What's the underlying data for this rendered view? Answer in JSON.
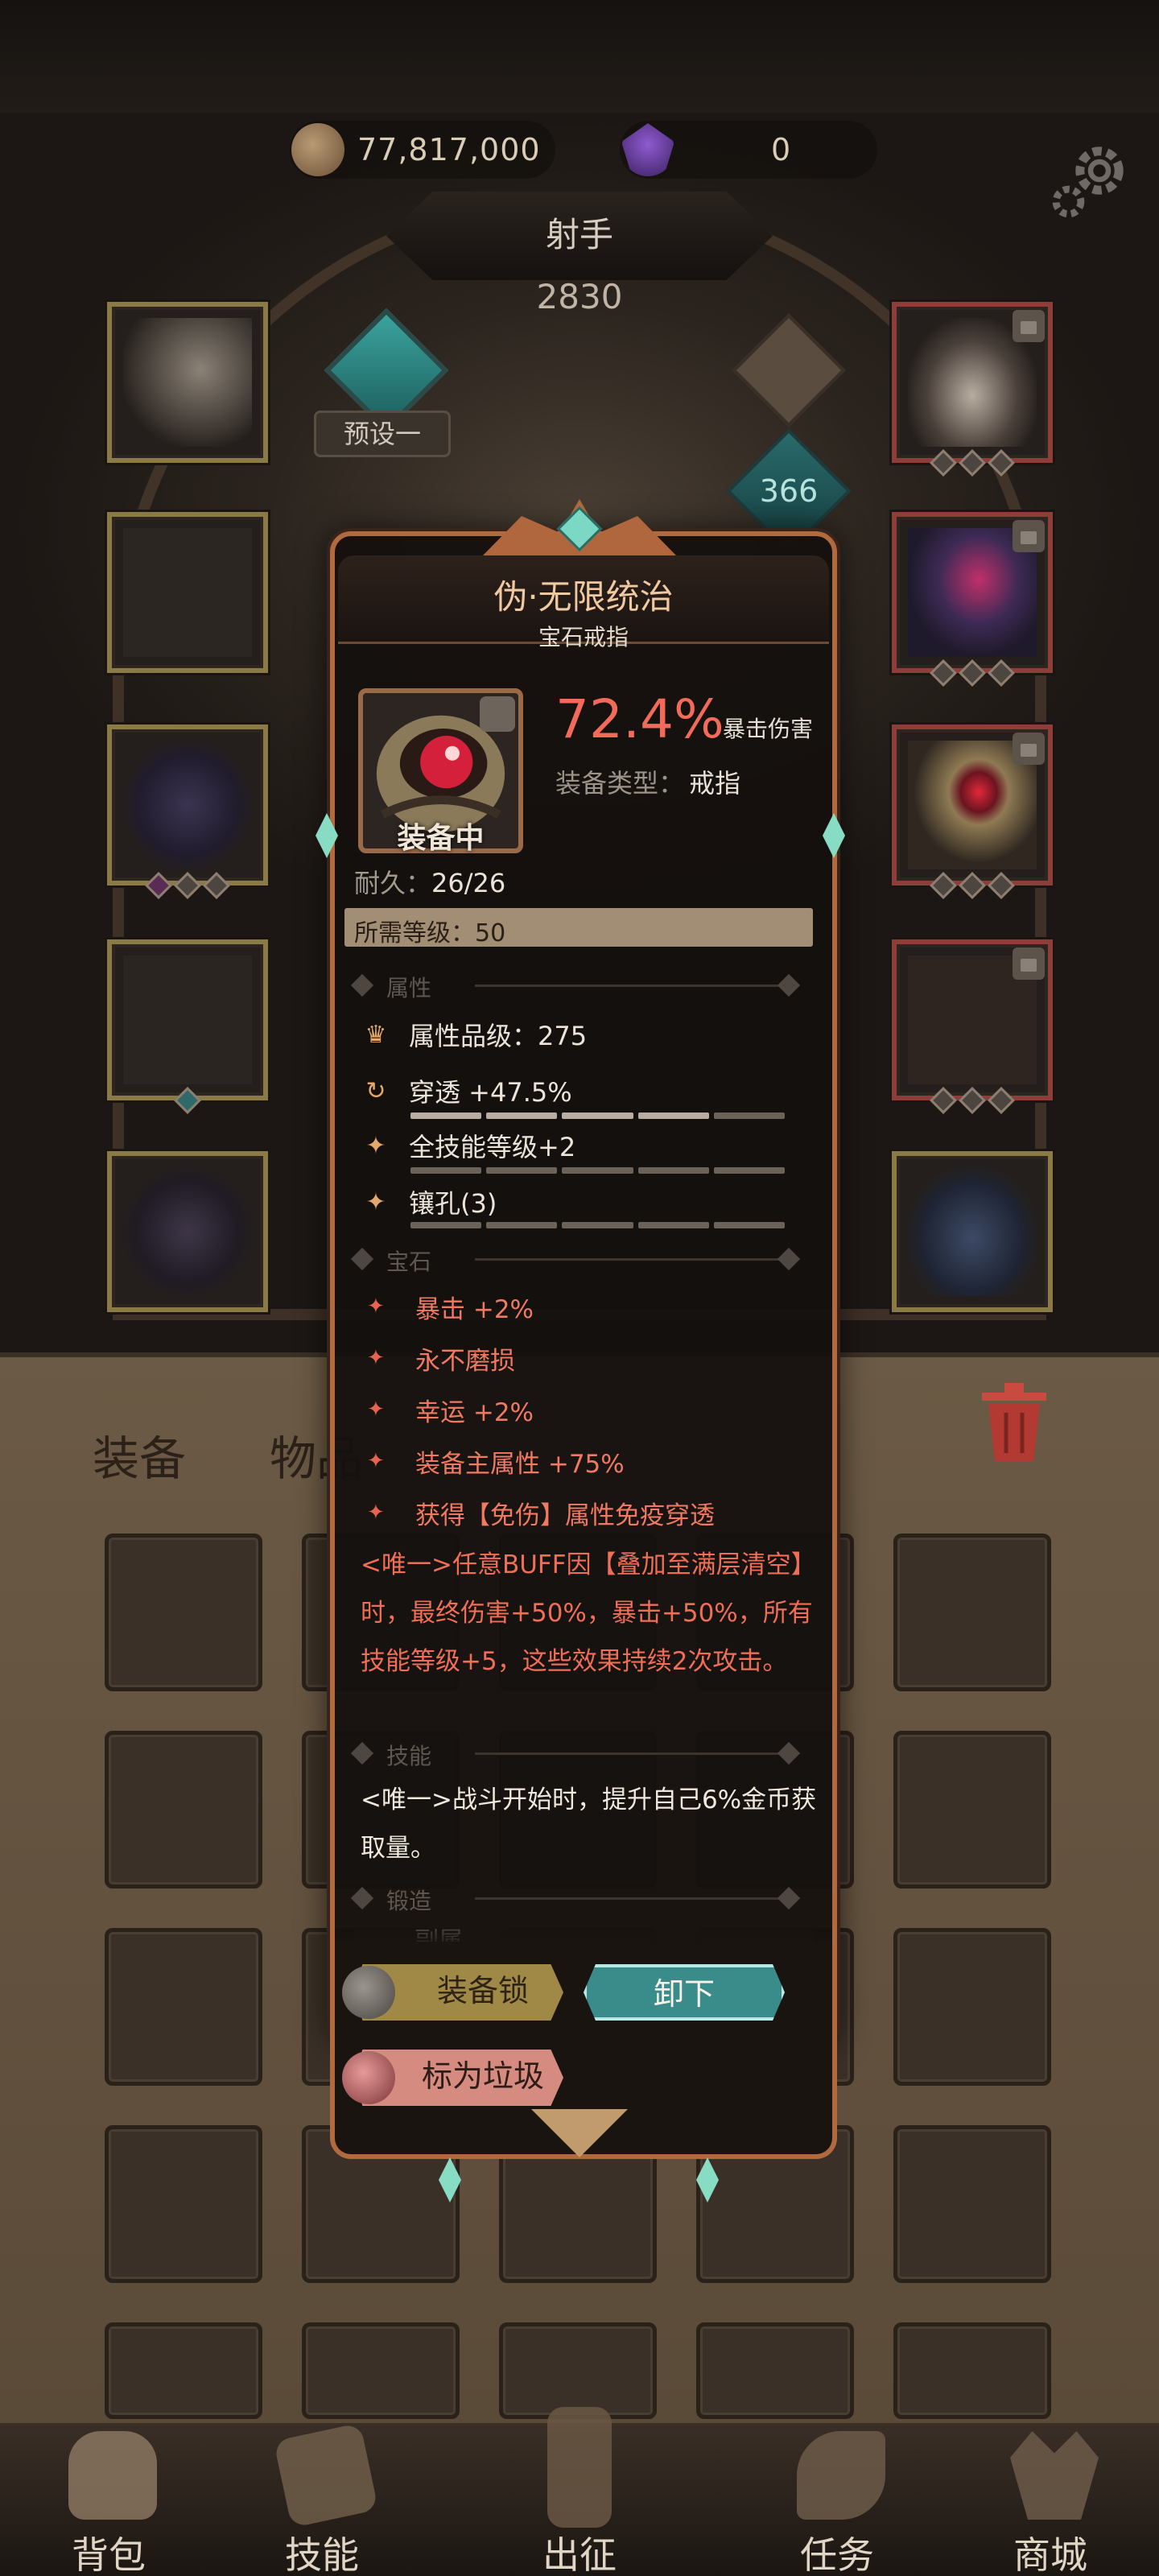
{
  "header": {
    "gold": "77,817,000",
    "gems": "0",
    "class_name": "射手",
    "power": "2830",
    "preset_label": "预设一",
    "level": "366"
  },
  "board": {
    "tab_equipment": "装备",
    "tab_items": "物品"
  },
  "item": {
    "name": "伪·无限统治",
    "type": "宝石戒指",
    "main_stat_value": "72.4%",
    "main_stat_label": "暴击伤害",
    "equip_type_label": "装备类型：",
    "equip_type_value": "戒指",
    "equipped_label": "装备中",
    "durability_label": "耐久：",
    "durability_value": "26/26",
    "required_level": "所需等级：50",
    "section_attributes": "属性",
    "attributes": [
      {
        "text": "属性品级：275",
        "icon": "crown-icon"
      },
      {
        "text": "穿透 +47.5%",
        "icon": "refresh-icon",
        "fill": 0.8
      },
      {
        "text": "全技能等级+2",
        "icon": "sparkle-icon",
        "fill": 0.0
      },
      {
        "text": "镶孔(3)",
        "icon": "sparkle-icon",
        "fill": 0.0
      }
    ],
    "section_gems": "宝石",
    "gems": [
      "暴击 +2%",
      "永不磨损",
      "幸运 +2%",
      "装备主属性 +75%",
      "获得【免伤】属性免疫穿透"
    ],
    "unique_effect": "<唯一>任意BUFF因【叠加至满层清空】时，最终伤害+50%，暴击+50%，所有技能等级+5，这些效果持续2次攻击。",
    "section_skills": "技能",
    "skill_text": "<唯一>战斗开始时，提升自己6%金币获取量。",
    "section_forge": "锻造",
    "forge_partial": "副属",
    "btn_lock": "装备锁",
    "btn_unequip": "卸下",
    "btn_junk": "标为垃圾"
  },
  "nav": [
    {
      "label": "背包",
      "icon": "backpack-icon"
    },
    {
      "label": "技能",
      "icon": "skill-book-icon"
    },
    {
      "label": "出征",
      "icon": "sword-scroll-icon"
    },
    {
      "label": "任务",
      "icon": "horn-icon"
    },
    {
      "label": "商城",
      "icon": "shop-crown-icon"
    }
  ],
  "colors": {
    "accent_red": "#f26b5a",
    "frame_copper": "#b06a3e",
    "teal_button": "#3a8c8a"
  }
}
